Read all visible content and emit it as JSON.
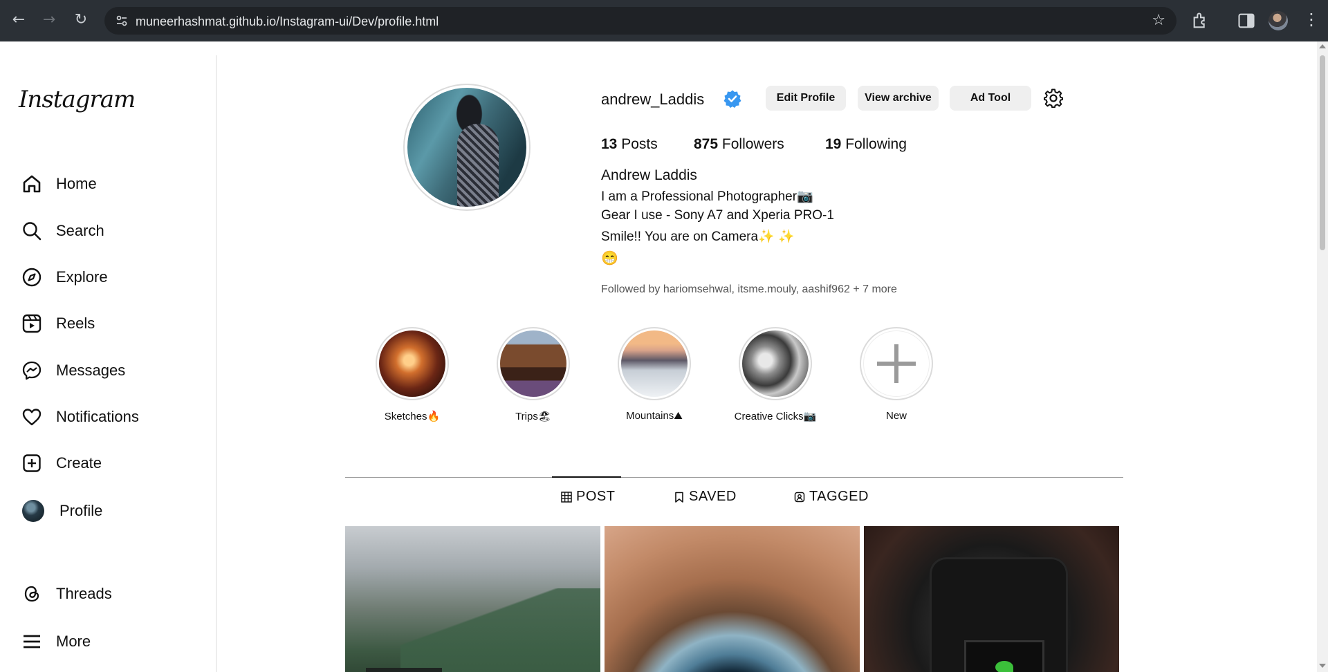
{
  "browser": {
    "url": "muneerhashmat.github.io/Instagram-ui/Dev/profile.html"
  },
  "sidebar": {
    "logo": "Instagram",
    "items": [
      {
        "label": "Home",
        "icon": "home-icon"
      },
      {
        "label": "Search",
        "icon": "search-icon"
      },
      {
        "label": "Explore",
        "icon": "explore-icon"
      },
      {
        "label": "Reels",
        "icon": "reels-icon"
      },
      {
        "label": "Messages",
        "icon": "messages-icon"
      },
      {
        "label": "Notifications",
        "icon": "heart-icon"
      },
      {
        "label": "Create",
        "icon": "create-icon"
      },
      {
        "label": "Profile",
        "icon": "avatar"
      }
    ],
    "bottom_items": [
      {
        "label": "Threads",
        "icon": "threads-icon"
      },
      {
        "label": "More",
        "icon": "menu-icon"
      }
    ]
  },
  "profile": {
    "username": "andrew_Laddis",
    "buttons": {
      "edit": "Edit Profile",
      "archive": "View archive",
      "ad": "Ad Tool"
    },
    "stats": {
      "posts_count": "13",
      "posts_label": "Posts",
      "followers_count": "875",
      "followers_label": "Followers",
      "following_count": "19",
      "following_label": "Following"
    },
    "full_name": "Andrew Laddis",
    "bio": [
      "I am a Professional Photographer📷",
      "Gear I use - Sony A7 and Xperia PRO-1",
      "Smile!! You are on Camera✨ ✨",
      "😁"
    ],
    "followed_by": "Followed by hariomsehwal, itsme.mouly, aashif962 + 7 more"
  },
  "highlights": [
    {
      "label": "Sketches🔥"
    },
    {
      "label": "Trips🏖"
    },
    {
      "label": "Mountains⛰"
    },
    {
      "label": "Creative Clicks📷"
    },
    {
      "label": "New"
    }
  ],
  "tabs": [
    {
      "label": "POST",
      "active": true
    },
    {
      "label": "SAVED",
      "active": false
    },
    {
      "label": "TAGGED",
      "active": false
    }
  ],
  "colors": {
    "verified": "#3897f0",
    "button_bg": "#efefef"
  }
}
